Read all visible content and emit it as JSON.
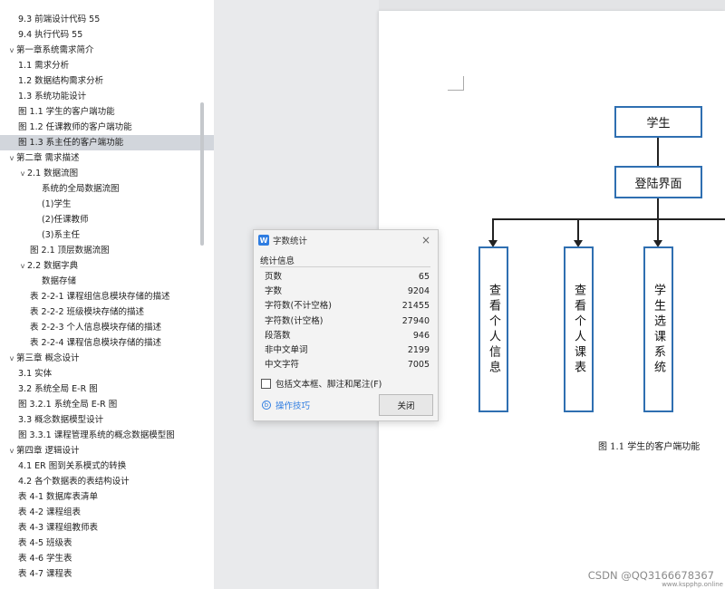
{
  "outline": {
    "items": [
      {
        "label": "9.3  前端设计代码  55",
        "level": 0,
        "chevron": ""
      },
      {
        "label": "9.4  执行代码  55",
        "level": 0,
        "chevron": ""
      },
      {
        "label": "第一章系统需求简介",
        "level": 0,
        "chevron": "v"
      },
      {
        "label": "1.1 需求分析",
        "level": 1,
        "chevron": ""
      },
      {
        "label": "1.2  数据结构需求分析",
        "level": 1,
        "chevron": ""
      },
      {
        "label": "1.3 系统功能设计",
        "level": 1,
        "chevron": ""
      },
      {
        "label": "图 1.1  学生的客户端功能",
        "level": 1,
        "chevron": ""
      },
      {
        "label": "图 1.2  任课教师的客户端功能",
        "level": 1,
        "chevron": ""
      },
      {
        "label": "图 1.3  系主任的客户端功能",
        "level": 1,
        "chevron": "",
        "selected": true
      },
      {
        "label": "第二章  需求描述",
        "level": 0,
        "chevron": "v"
      },
      {
        "label": "2.1  数据流图",
        "level": 1,
        "chevron": "v"
      },
      {
        "label": "系统的全局数据流图",
        "level": 3,
        "chevron": ""
      },
      {
        "label": "(1)学生",
        "level": 3,
        "chevron": ""
      },
      {
        "label": "(2)任课教师",
        "level": 3,
        "chevron": ""
      },
      {
        "label": "(3)系主任",
        "level": 3,
        "chevron": ""
      },
      {
        "label": "图 2.1  顶层数据流图",
        "level": 2,
        "chevron": ""
      },
      {
        "label": "2.2  数据字典",
        "level": 1,
        "chevron": "v"
      },
      {
        "label": "数据存储",
        "level": 3,
        "chevron": ""
      },
      {
        "label": "表 2-2-1  课程组信息模块存储的描述",
        "level": 2,
        "chevron": ""
      },
      {
        "label": "表 2-2-2  班级模块存储的描述",
        "level": 2,
        "chevron": ""
      },
      {
        "label": "表 2-2-3  个人信息模块存储的描述",
        "level": 2,
        "chevron": ""
      },
      {
        "label": "表 2-2-4  课程信息模块存储的描述",
        "level": 2,
        "chevron": ""
      },
      {
        "label": "第三章    概念设计",
        "level": 0,
        "chevron": "v"
      },
      {
        "label": "3.1  实体",
        "level": 1,
        "chevron": ""
      },
      {
        "label": "3.2  系统全局 E-R 图",
        "level": 1,
        "chevron": ""
      },
      {
        "label": "图 3.2.1  系统全局 E-R 图",
        "level": 1,
        "chevron": ""
      },
      {
        "label": "3.3  概念数据模型设计",
        "level": 1,
        "chevron": ""
      },
      {
        "label": "图 3.3.1  课程管理系统的概念数据模型图",
        "level": 1,
        "chevron": ""
      },
      {
        "label": "第四章  逻辑设计",
        "level": 0,
        "chevron": "v"
      },
      {
        "label": "4.1 ER 图到关系模式的转换",
        "level": 1,
        "chevron": ""
      },
      {
        "label": "4.2    各个数据表的表结构设计",
        "level": 1,
        "chevron": ""
      },
      {
        "label": "表 4-1  数据库表清单",
        "level": 1,
        "chevron": ""
      },
      {
        "label": "表 4-2  课程组表",
        "level": 1,
        "chevron": ""
      },
      {
        "label": "表 4-3  课程组教师表",
        "level": 1,
        "chevron": ""
      },
      {
        "label": "表 4-5  班级表",
        "level": 1,
        "chevron": ""
      },
      {
        "label": "表 4-6  学生表",
        "level": 1,
        "chevron": ""
      },
      {
        "label": "表 4-7  课程表",
        "level": 1,
        "chevron": ""
      }
    ]
  },
  "diagram": {
    "top_node": "学生",
    "login_node": "登陆界面",
    "children": [
      "查看个人信息",
      "查看个人课表",
      "学生选课系统"
    ],
    "caption": "图 1.1  学生的客户端功能"
  },
  "dialog": {
    "app_icon": "W",
    "title": "字数统计",
    "close_icon": "×",
    "section": "统计信息",
    "rows": [
      {
        "label": "页数",
        "value": "65"
      },
      {
        "label": "字数",
        "value": "9204"
      },
      {
        "label": "字符数(不计空格)",
        "value": "21455"
      },
      {
        "label": "字符数(计空格)",
        "value": "27940"
      },
      {
        "label": "段落数",
        "value": "946"
      },
      {
        "label": "非中文单词",
        "value": "2199"
      },
      {
        "label": "中文字符",
        "value": "7005"
      }
    ],
    "checkbox_label": "包括文本框、脚注和尾注(F)",
    "checkbox_checked": false,
    "tips_icon": "b",
    "tips_label": "操作技巧",
    "close_button": "关闭"
  },
  "watermark": {
    "text": "CSDN @QQ3166678367",
    "sub": "www.kspphp.online"
  },
  "colors": {
    "node_border": "#2f6fb1",
    "selected_bg": "#d2d6dc",
    "link": "#2f7de1"
  }
}
